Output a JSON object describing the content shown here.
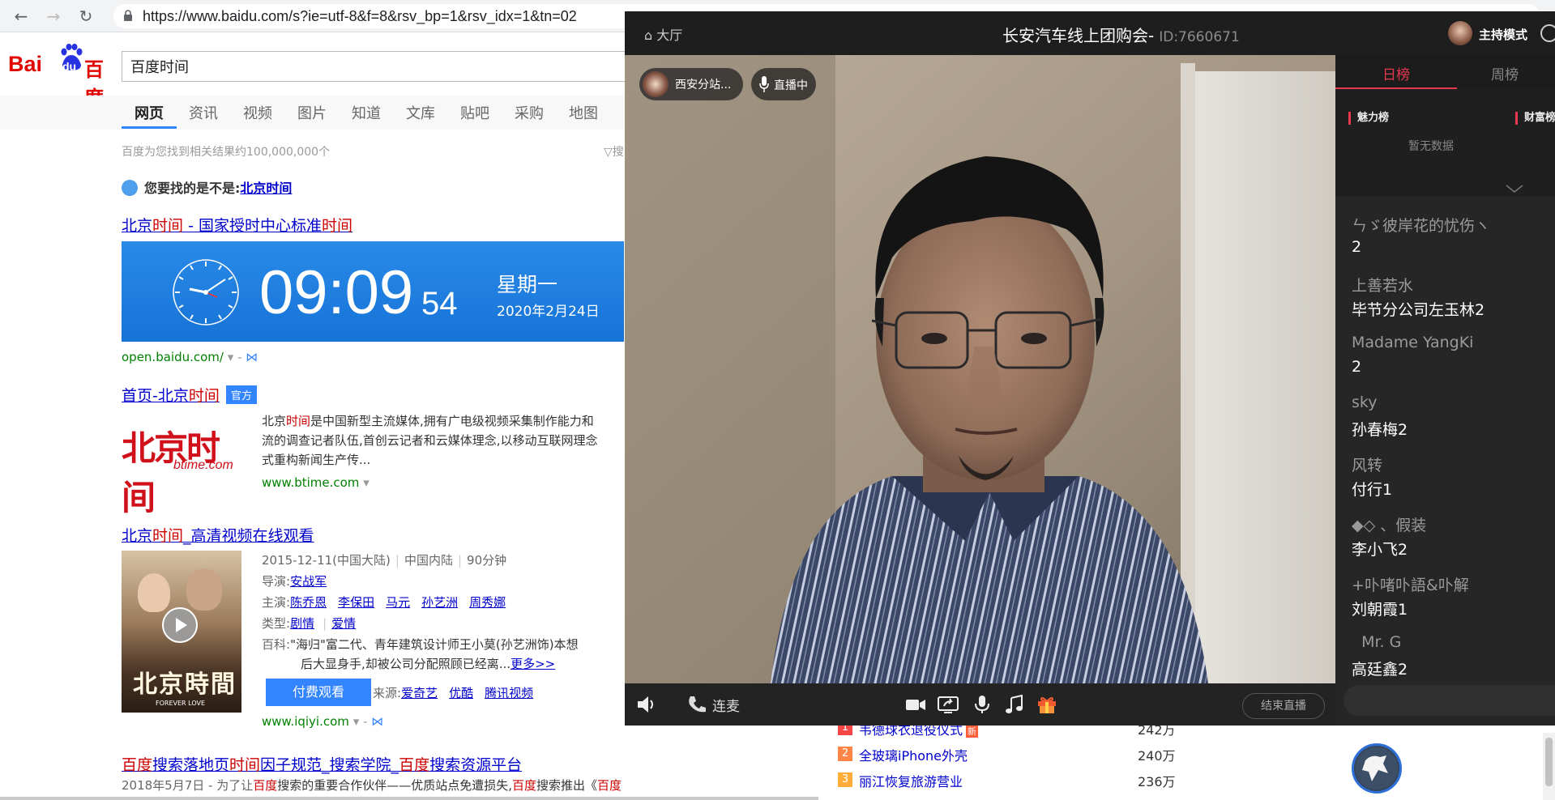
{
  "browser": {
    "url": "https://www.baidu.com/s?ie=utf-8&f=8&rsv_bp=1&rsv_idx=1&tn=02",
    "nav": {
      "back": "←",
      "forward": "→",
      "reload": "↻"
    }
  },
  "baidu": {
    "logo": {
      "bai": "Bai",
      "du": "du",
      "baidu_cn": "百度"
    },
    "search_value": "百度时间",
    "tabs": [
      "网页",
      "资讯",
      "视频",
      "图片",
      "知道",
      "文库",
      "贴吧",
      "采购",
      "地图"
    ],
    "active_tab": "网页",
    "result_count": "百度为您找到相关结果约100,000,000个",
    "filter_label": "▽搜",
    "maybe_prefix": "您要找的是不是:",
    "maybe_link": "北京时间",
    "results": {
      "r1": {
        "t1": "北京",
        "t2": "时间",
        "t3": " - 国家授时中心标准",
        "t4": "时间",
        "time": "09:09",
        "seconds": "54",
        "weekday": "星期一",
        "date": "2020年2月24日",
        "url": "open.baidu.com/",
        "url_suffix": "▾ -"
      },
      "r2": {
        "t1": "首页-北京",
        "t2": "时间",
        "badge": "官方",
        "logo_main": "北京时间",
        "logo_sub": "btime.com",
        "d1a": "北京",
        "d1b": "时间",
        "d1c": "是中国新型主流媒体,拥有广电级视频采集制作能力和",
        "d2": "流的调查记者队伍,首创云记者和云媒体理念,以移动互联网理念",
        "d3": "式重构新闻生产传...",
        "url": "www.btime.com",
        "url_suffix": "▾"
      },
      "r3": {
        "t1": "北京",
        "t2": "时间",
        "t3": "_高清视频在线观看",
        "poster_title": "北京時間",
        "poster_sub": "FOREVER LOVE",
        "info_date": "2015-12-11(中国大陆)",
        "info_region": "中国内陆",
        "info_length": "90分钟",
        "director_label": "导演:",
        "director": "安战军",
        "cast_label": "主演:",
        "cast": [
          "陈乔恩",
          "李保田",
          "马元",
          "孙艺洲",
          "周秀娜"
        ],
        "genre_label": "类型:",
        "genre": [
          "剧情",
          "爱情"
        ],
        "wiki_label": "百科:",
        "wiki1": "\"海归\"富二代、青年建筑设计师王小莫(孙艺洲饰)本想",
        "wiki2": "后大显身手,却被公司分配照顾已经离...",
        "more": "更多>>",
        "pay_button": "付费观看",
        "source_label": "来源:",
        "sources": [
          "爱奇艺",
          "优酷",
          "腾讯视频"
        ],
        "url": "www.iqiyi.com",
        "url_suffix": "▾ -"
      },
      "r4": {
        "t1": "百度",
        "t2": "搜索落地页",
        "t3": "时间",
        "t4": "因子规范_搜索学院_",
        "t5": "百度",
        "t6": "搜索资源平台",
        "d1a": "2018年5月7日 - 为了让",
        "d1b": "百度",
        "d1c": "搜索的重要合作伙伴——优质站点免遭损失,",
        "d1d": "百度",
        "d1e": "搜索推出《",
        "d1f": "百度"
      }
    },
    "hot": [
      {
        "rank": "1",
        "text": "韦德球衣退役仪式",
        "badge": "新",
        "value": "242万",
        "color": "#f54545"
      },
      {
        "rank": "2",
        "text": "全玻璃iPhone外壳",
        "badge": "",
        "value": "240万",
        "color": "#ff8547"
      },
      {
        "rank": "3",
        "text": "丽江恢复旅游营业",
        "badge": "",
        "value": "236万",
        "color": "#ffac38"
      }
    ]
  },
  "live": {
    "hall": "大厅",
    "title": "长安汽车线上团购会-",
    "id": "ID:7660671",
    "host_mode": "主持模式",
    "station": "西安分站...",
    "status": "直播中",
    "lianmai": "连麦",
    "end_button": "结束直播",
    "rank_tabs": [
      "日榜",
      "周榜"
    ],
    "rank_left": "魅力榜",
    "rank_right": "财富榜",
    "empty": "暂无数据",
    "messages": [
      {
        "name": "ㄣゞ彼岸花的忧伤ヽ",
        "text": "2"
      },
      {
        "name": "上善若水",
        "text": "毕节分公司左玉林2"
      },
      {
        "name": "Madame YangKi",
        "text": "2"
      },
      {
        "name": "sky",
        "text": "孙春梅2"
      },
      {
        "name": "风转",
        "text": "付行1"
      },
      {
        "name": "◆◇ 、假装",
        "text": "李小飞2"
      },
      {
        "name": "+卟啫卟語&卟解",
        "text": "刘朝霞1"
      },
      {
        "name": "  Mr. G",
        "text": "高廷鑫2"
      }
    ]
  }
}
